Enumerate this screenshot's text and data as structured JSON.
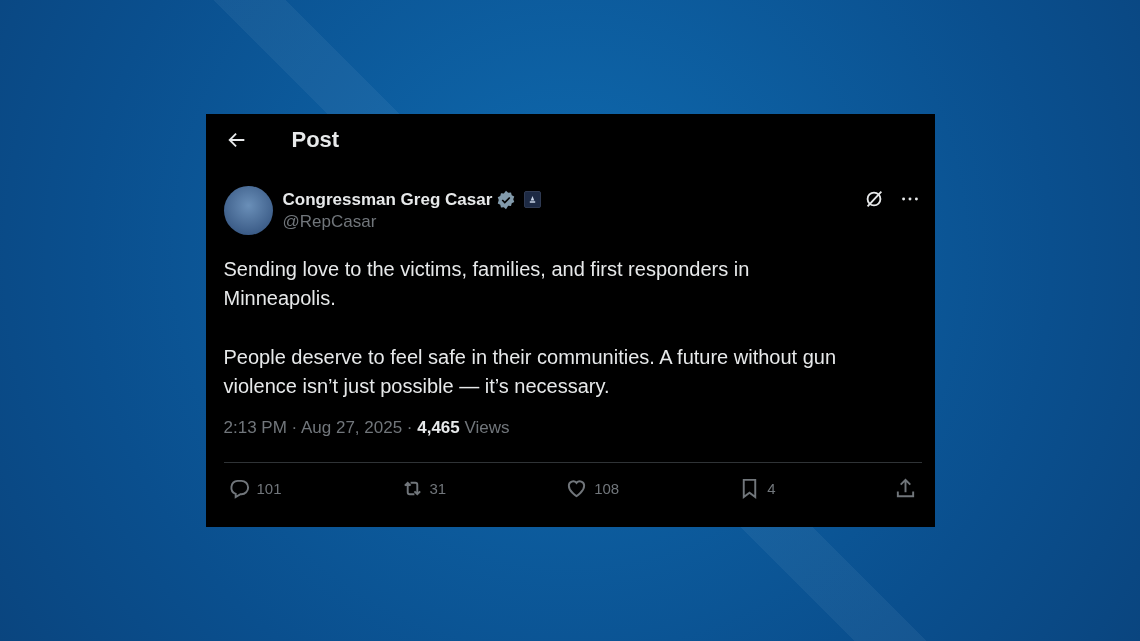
{
  "header": {
    "title": "Post"
  },
  "author": {
    "name": "Congressman Greg Casar",
    "handle": "@RepCasar"
  },
  "body": [
    "Sending love to the victims, families, and first responders in Minneapolis.",
    "People deserve to feel safe in their communities. A future without gun violence isn’t just possible — it’s necessary."
  ],
  "meta": "2:13 PM · Aug 27, 2025 · **4,465** Views",
  "actions": [
    {
      "kind": "reply",
      "count": "101"
    },
    {
      "kind": "repost",
      "count": "31"
    },
    {
      "kind": "like",
      "count": "108"
    },
    {
      "kind": "bookmark",
      "count": "4"
    },
    {
      "kind": "share"
    }
  ]
}
